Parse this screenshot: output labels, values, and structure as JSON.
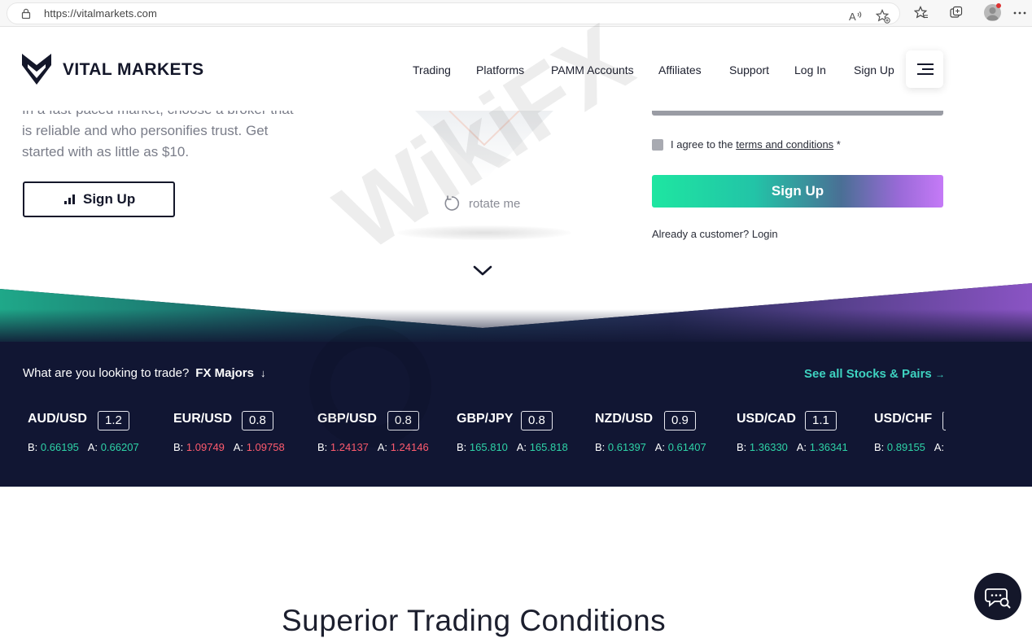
{
  "browser": {
    "url": "https://vitalmarkets.com",
    "icons": [
      "lock-icon",
      "read-aloud-icon",
      "favorite-add-icon",
      "favorites-icon",
      "collections-icon",
      "profile-avatar",
      "more-icon"
    ]
  },
  "header": {
    "logo_text": "VITAL MARKETS",
    "nav": [
      "Trading",
      "Platforms",
      "PAMM Accounts",
      "Affiliates",
      "Support",
      "Log In",
      "Sign Up"
    ]
  },
  "hero": {
    "text_partial": "In a fast-paced market, choose a broker that",
    "text_line2": "is reliable and who personifies trust. Get",
    "text_line3": "started with as little as $10.",
    "signup_label": "Sign Up",
    "rotate_label": "rotate me"
  },
  "form": {
    "agree_prefix": "I agree to the ",
    "agree_link": "terms and conditions",
    "agree_suffix": " *",
    "signup_label": "Sign Up",
    "login_text": "Already a customer? Login"
  },
  "ticker": {
    "question": "What are you looking to trade?",
    "selected": "FX Majors",
    "selected_arrow": "↓",
    "see_all": "See all Stocks & Pairs",
    "see_all_arrow": "→",
    "bid_label": "B:",
    "ask_label": "A:",
    "pairs": [
      {
        "symbol": "AUD/USD",
        "spread": "1.2",
        "bid": "0.66195",
        "ask": "0.66207",
        "direction": "up"
      },
      {
        "symbol": "EUR/USD",
        "spread": "0.8",
        "bid": "1.09749",
        "ask": "1.09758",
        "direction": "down"
      },
      {
        "symbol": "GBP/USD",
        "spread": "0.8",
        "bid": "1.24137",
        "ask": "1.24146",
        "direction": "down"
      },
      {
        "symbol": "GBP/JPY",
        "spread": "0.8",
        "bid": "165.810",
        "ask": "165.818",
        "direction": "up"
      },
      {
        "symbol": "NZD/USD",
        "spread": "0.9",
        "bid": "0.61397",
        "ask": "0.61407",
        "direction": "up"
      },
      {
        "symbol": "USD/CAD",
        "spread": "1.1",
        "bid": "1.36330",
        "ask": "1.36341",
        "direction": "up"
      },
      {
        "symbol": "USD/CHF",
        "spread": "",
        "bid": "0.89155",
        "ask": "",
        "direction": "up"
      }
    ]
  },
  "section": {
    "title": "Superior Trading Conditions"
  },
  "watermark": "WikiFX",
  "colors": {
    "navy": "#14172a",
    "teal": "#3ed2c0",
    "green_price": "#2ed3a7",
    "red_price": "#ff5b6e",
    "gradient_start": "#1ee6a1",
    "gradient_end": "#c57af7"
  }
}
